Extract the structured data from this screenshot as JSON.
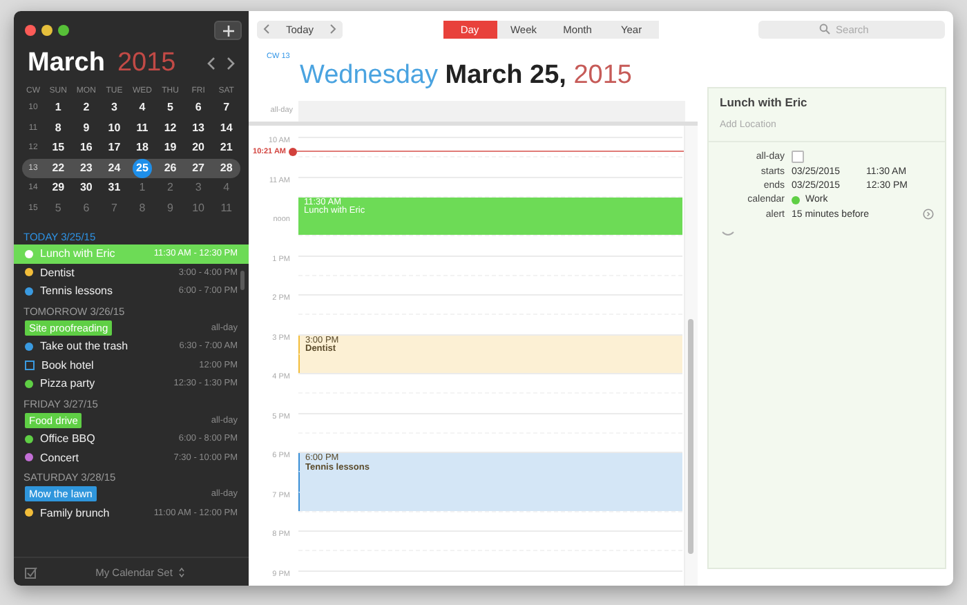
{
  "sidebar": {
    "mini_calendar": {
      "month": "March",
      "year": "2015",
      "headers": [
        "CW",
        "SUN",
        "MON",
        "TUE",
        "WED",
        "THU",
        "FRI",
        "SAT"
      ],
      "weeks": [
        {
          "number": "10",
          "selected": false,
          "days": [
            {
              "label": "1",
              "selected": false,
              "other_month": false
            },
            {
              "label": "2",
              "selected": false,
              "other_month": false
            },
            {
              "label": "3",
              "selected": false,
              "other_month": false
            },
            {
              "label": "4",
              "selected": false,
              "other_month": false
            },
            {
              "label": "5",
              "selected": false,
              "other_month": false
            },
            {
              "label": "6",
              "selected": false,
              "other_month": false
            },
            {
              "label": "7",
              "selected": false,
              "other_month": false
            }
          ]
        },
        {
          "number": "11",
          "selected": false,
          "days": [
            {
              "label": "8",
              "selected": false,
              "other_month": false
            },
            {
              "label": "9",
              "selected": false,
              "other_month": false
            },
            {
              "label": "10",
              "selected": false,
              "other_month": false
            },
            {
              "label": "11",
              "selected": false,
              "other_month": false
            },
            {
              "label": "12",
              "selected": false,
              "other_month": false
            },
            {
              "label": "13",
              "selected": false,
              "other_month": false
            },
            {
              "label": "14",
              "selected": false,
              "other_month": false
            }
          ]
        },
        {
          "number": "12",
          "selected": false,
          "days": [
            {
              "label": "15",
              "selected": false,
              "other_month": false
            },
            {
              "label": "16",
              "selected": false,
              "other_month": false
            },
            {
              "label": "17",
              "selected": false,
              "other_month": false
            },
            {
              "label": "18",
              "selected": false,
              "other_month": false
            },
            {
              "label": "19",
              "selected": false,
              "other_month": false
            },
            {
              "label": "20",
              "selected": false,
              "other_month": false
            },
            {
              "label": "21",
              "selected": false,
              "other_month": false
            }
          ]
        },
        {
          "number": "13",
          "selected": true,
          "days": [
            {
              "label": "22",
              "selected": false,
              "other_month": false
            },
            {
              "label": "23",
              "selected": false,
              "other_month": false
            },
            {
              "label": "24",
              "selected": false,
              "other_month": false
            },
            {
              "label": "25",
              "selected": true,
              "other_month": false
            },
            {
              "label": "26",
              "selected": false,
              "other_month": false
            },
            {
              "label": "27",
              "selected": false,
              "other_month": false
            },
            {
              "label": "28",
              "selected": false,
              "other_month": false
            }
          ]
        },
        {
          "number": "14",
          "selected": false,
          "days": [
            {
              "label": "29",
              "selected": false,
              "other_month": false
            },
            {
              "label": "30",
              "selected": false,
              "other_month": false
            },
            {
              "label": "31",
              "selected": false,
              "other_month": false
            },
            {
              "label": "1",
              "selected": false,
              "other_month": true
            },
            {
              "label": "2",
              "selected": false,
              "other_month": true
            },
            {
              "label": "3",
              "selected": false,
              "other_month": true
            },
            {
              "label": "4",
              "selected": false,
              "other_month": true
            }
          ]
        },
        {
          "number": "15",
          "selected": false,
          "days": [
            {
              "label": "5",
              "selected": false,
              "other_month": true
            },
            {
              "label": "6",
              "selected": false,
              "other_month": true
            },
            {
              "label": "7",
              "selected": false,
              "other_month": true
            },
            {
              "label": "8",
              "selected": false,
              "other_month": true
            },
            {
              "label": "9",
              "selected": false,
              "other_month": true
            },
            {
              "label": "10",
              "selected": false,
              "other_month": true
            },
            {
              "label": "11",
              "selected": false,
              "other_month": true
            }
          ]
        }
      ]
    },
    "agenda": [
      {
        "heading": "TODAY 3/25/15",
        "today": true,
        "items": [
          {
            "kind": "dot",
            "title": "Lunch with Eric",
            "time": "11:30 AM - 12:30 PM",
            "color": "#6ddb56",
            "selected": true
          },
          {
            "kind": "dot",
            "title": "Dentist",
            "time": "3:00 - 4:00 PM",
            "color": "#f2bd3a",
            "selected": false
          },
          {
            "kind": "dot",
            "title": "Tennis lessons",
            "time": "6:00 - 7:00 PM",
            "color": "#3a9ae0",
            "selected": false
          }
        ]
      },
      {
        "heading": "TOMORROW 3/26/15",
        "today": false,
        "items": [
          {
            "kind": "tag",
            "title": "Site proofreading",
            "time": "all-day",
            "color": "#5fcf45",
            "selected": false
          },
          {
            "kind": "dot",
            "title": "Take out the trash",
            "time": "6:30 - 7:00 AM",
            "color": "#3a9ae0",
            "selected": false
          },
          {
            "kind": "task",
            "title": "Book hotel",
            "time": "12:00 PM",
            "color": "#3a9ae0",
            "selected": false
          },
          {
            "kind": "dot",
            "title": "Pizza party",
            "time": "12:30 - 1:30 PM",
            "color": "#5fcf45",
            "selected": false
          }
        ]
      },
      {
        "heading": "FRIDAY 3/27/15",
        "today": false,
        "items": [
          {
            "kind": "tag",
            "title": "Food drive",
            "time": "all-day",
            "color": "#5fcf45",
            "selected": false
          },
          {
            "kind": "dot",
            "title": "Office BBQ",
            "time": "6:00 - 8:00 PM",
            "color": "#5fcf45",
            "selected": false
          },
          {
            "kind": "dot",
            "title": "Concert",
            "time": "7:30 - 10:00 PM",
            "color": "#c36fd6",
            "selected": false
          }
        ]
      },
      {
        "heading": "SATURDAY 3/28/15",
        "today": false,
        "items": [
          {
            "kind": "tag",
            "title": "Mow the lawn",
            "time": "all-day",
            "color": "#2f96dc",
            "selected": false
          },
          {
            "kind": "dot",
            "title": "Family brunch",
            "time": "11:00 AM - 12:00 PM",
            "color": "#f2bd3a",
            "selected": false
          }
        ]
      }
    ],
    "footer": {
      "calendar_set": "My Calendar Set"
    }
  },
  "toolbar": {
    "today_button": "Today",
    "view_tabs": [
      {
        "label": "Day",
        "selected": true
      },
      {
        "label": "Week",
        "selected": false
      },
      {
        "label": "Month",
        "selected": false
      },
      {
        "label": "Year",
        "selected": false
      }
    ],
    "search": {
      "placeholder": "Search"
    }
  },
  "day_view": {
    "week_label": "CW 13",
    "weekday": "Wednesday",
    "date": "March 25,",
    "year": "2015",
    "all_day_label": "all-day",
    "hours": [
      {
        "label": "10 AM",
        "now": {
          "label": "10:21 AM"
        }
      },
      {
        "label": "11 AM",
        "second_half": {
          "event": {
            "time": "11:30 AM",
            "title": "Lunch with Eric",
            "color": "#6ddb56",
            "selected": true
          }
        }
      },
      {
        "label": "noon",
        "continues": true
      },
      {
        "label": "1 PM"
      },
      {
        "label": "2 PM"
      },
      {
        "label": "3 PM",
        "event": {
          "time": "3:00 PM",
          "title": "Dentist",
          "color": "#f2bd3a",
          "selected": false
        },
        "second_half": {
          "continues": true
        }
      },
      {
        "label": "4 PM"
      },
      {
        "label": "5 PM"
      },
      {
        "label": "6 PM",
        "event": {
          "time": "6:00 PM",
          "title": "Tennis lessons",
          "color": "#3a8fd6",
          "selected": false
        },
        "second_half": {
          "continues": true
        }
      },
      {
        "label": "7 PM",
        "continues": true
      },
      {
        "label": "8 PM"
      },
      {
        "label": "9 PM"
      }
    ]
  },
  "detail": {
    "title": "Lunch with Eric",
    "location_placeholder": "Add Location",
    "fields": [
      {
        "kind": "checkbox",
        "label": "all-day",
        "checked": false
      },
      {
        "kind": "datetime",
        "label": "starts",
        "date": "03/25/2015",
        "time": "11:30 AM"
      },
      {
        "kind": "datetime",
        "label": "ends",
        "date": "03/25/2015",
        "time": "12:30 PM"
      },
      {
        "kind": "calendar",
        "label": "calendar",
        "value": "Work",
        "color": "#5fcf45"
      },
      {
        "kind": "alert",
        "label": "alert",
        "value": "15 minutes before"
      }
    ]
  }
}
